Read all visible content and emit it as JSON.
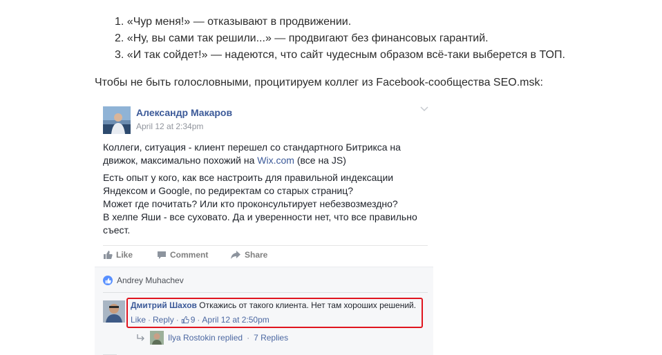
{
  "article": {
    "list_items": [
      "«Чур меня!» — отказывают в продвижении.",
      "«Ну, вы сами так решили...» — продвигают без финансовых гарантий.",
      "«И так сойдет!» — надеются, что сайт чудесным образом всё-таки выберется в ТОП."
    ],
    "list_numbers": [
      "1.",
      "2.",
      "3."
    ],
    "intro": "Чтобы не быть голословными, процитируем коллег из Facebook-сообщества SEO.msk:"
  },
  "post": {
    "author": "Александр Макаров",
    "time": "April 12 at 2:34pm",
    "paragraph1_part1": "Коллеги, ситуация - клиент перешел со стандартного Битрикса на",
    "paragraph1_part2": "движок, максимально похожий на ",
    "link_text": "Wix.com",
    "paragraph1_part3": " (все на JS)",
    "paragraph2_lines": [
      "Есть опыт у кого, как все настроить для правильной индексации",
      "Яндексом и Google, по редиректам со старых страниц?",
      "Может где почитать? Или кто проконсультирует небезвозмездно?",
      "В хелпе Яши - все суховато. Да и уверенности нет, что все правильно",
      "съест."
    ],
    "actions": {
      "like": "Like",
      "comment": "Comment",
      "share": "Share"
    }
  },
  "comments": {
    "liker": "Andrey Muhachev",
    "comment": {
      "author": "Дмитрий Шахов",
      "text": " Откажись от такого клиента. Нет там хороших решений.",
      "like_label": "Like",
      "sep1": "·",
      "reply_label": "Reply",
      "sep2": "·",
      "likes_count": "9",
      "sep3": "·",
      "time": "April 12 at 2:50pm"
    },
    "reply": {
      "text": "Ilya Rostokin replied",
      "sep": "·",
      "count": "7 Replies"
    }
  },
  "colors": {
    "fb_blue": "#3b5998",
    "highlight": "#e0141e"
  },
  "icons": [
    "chevron-down-icon",
    "thumbs-up-icon",
    "comment-icon",
    "share-icon",
    "like-badge-icon"
  ]
}
